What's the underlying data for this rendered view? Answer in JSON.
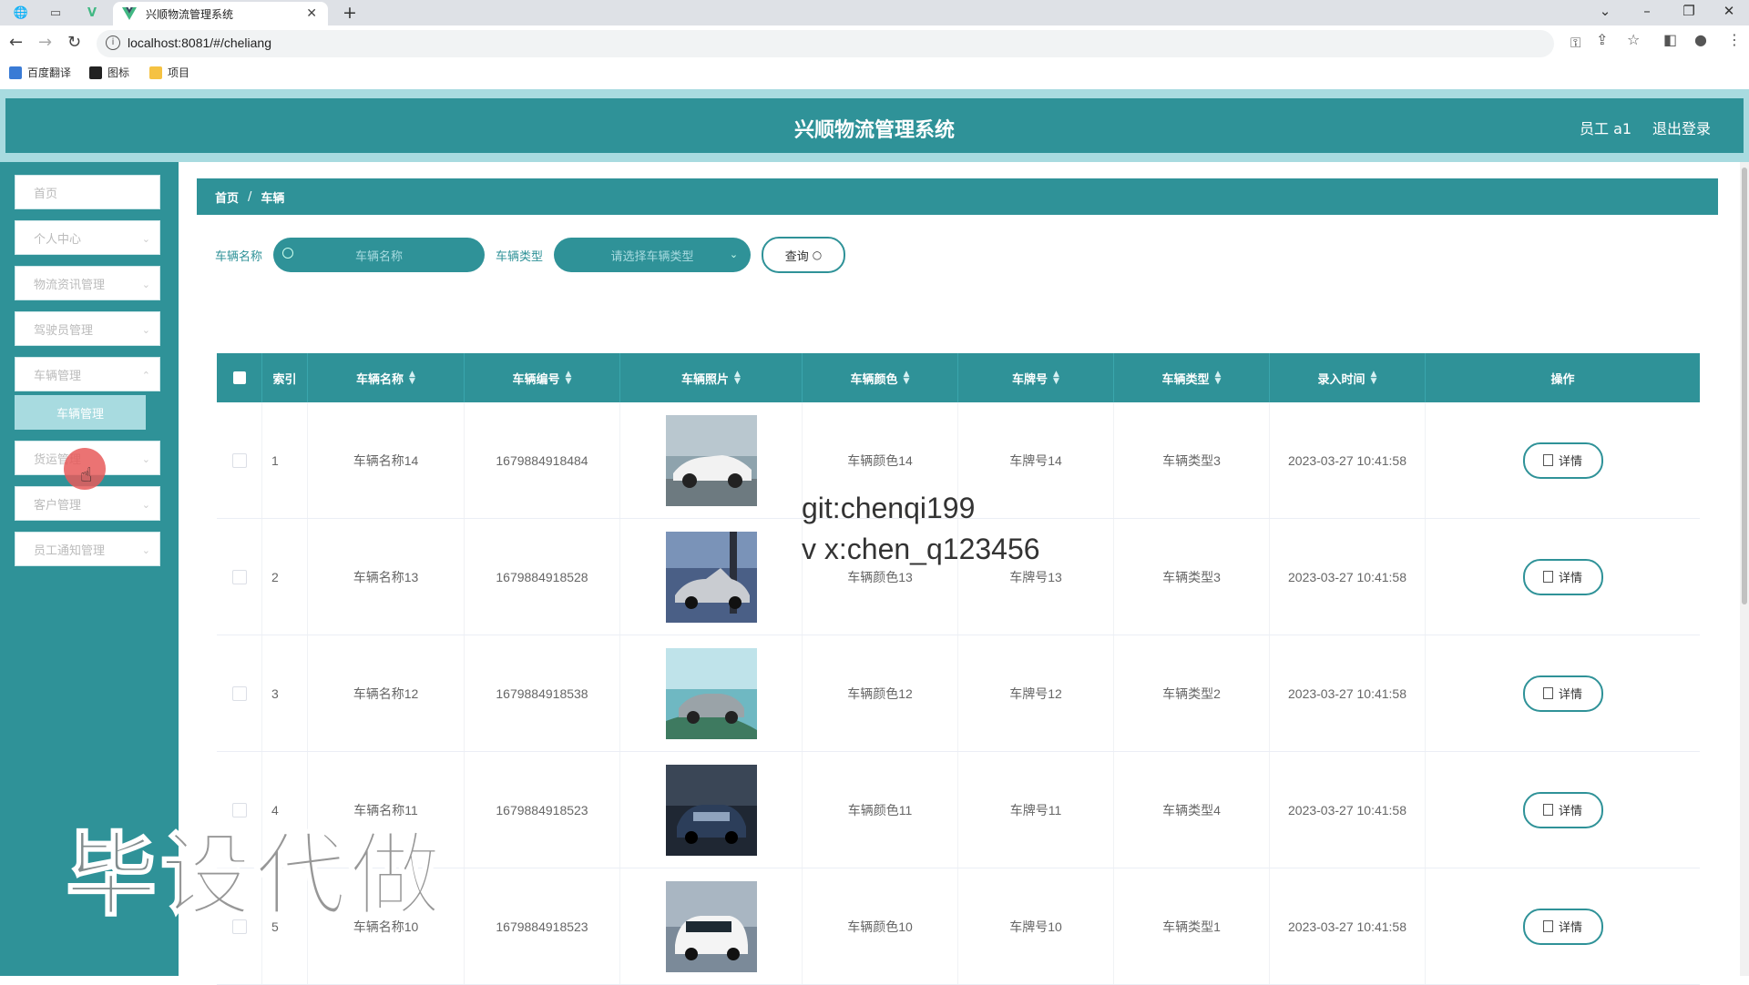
{
  "browser": {
    "tab_title": "兴顺物流管理系统",
    "url": "localhost:8081/#/cheliang",
    "bookmarks": [
      "百度翻译",
      "图标",
      "项目"
    ]
  },
  "header": {
    "title": "兴顺物流管理系统",
    "user": "员工 a1",
    "logout": "退出登录"
  },
  "sidebar": {
    "items": [
      "首页",
      "个人中心",
      "物流资讯管理",
      "驾驶员管理",
      "车辆管理",
      "货运管理",
      "客户管理",
      "员工通知管理"
    ],
    "submenu": "车辆管理"
  },
  "breadcrumb": {
    "home": "首页",
    "sep": "/",
    "current": "车辆"
  },
  "search": {
    "name_label": "车辆名称",
    "name_placeholder": "车辆名称",
    "type_label": "车辆类型",
    "type_placeholder": "请选择车辆类型",
    "query_label": "查询"
  },
  "table": {
    "columns": [
      "索引",
      "车辆名称",
      "车辆编号",
      "车辆照片",
      "车辆颜色",
      "车牌号",
      "车辆类型",
      "录入时间",
      "操作"
    ],
    "rows": [
      {
        "index": "1",
        "name": "车辆名称14",
        "code": "1679884918484",
        "color": "车辆颜色14",
        "plate": "车牌号14",
        "type": "车辆类型3",
        "time": "2023-03-27 10:41:58"
      },
      {
        "index": "2",
        "name": "车辆名称13",
        "code": "1679884918528",
        "color": "车辆颜色13",
        "plate": "车牌号13",
        "type": "车辆类型3",
        "time": "2023-03-27 10:41:58"
      },
      {
        "index": "3",
        "name": "车辆名称12",
        "code": "1679884918538",
        "color": "车辆颜色12",
        "plate": "车牌号12",
        "type": "车辆类型2",
        "time": "2023-03-27 10:41:58"
      },
      {
        "index": "4",
        "name": "车辆名称11",
        "code": "1679884918523",
        "color": "车辆颜色11",
        "plate": "车牌号11",
        "type": "车辆类型4",
        "time": "2023-03-27 10:41:58"
      },
      {
        "index": "5",
        "name": "车辆名称10",
        "code": "1679884918523",
        "color": "车辆颜色10",
        "plate": "车牌号10",
        "type": "车辆类型1",
        "time": "2023-03-27 10:41:58"
      }
    ],
    "detail_label": "详情"
  },
  "overlay": {
    "line1": "git:chenqi199",
    "line2": "v x:chen_q123456",
    "watermark": "毕设代做"
  },
  "colors": {
    "primary": "#2f9298",
    "light": "#a8dbe0"
  }
}
